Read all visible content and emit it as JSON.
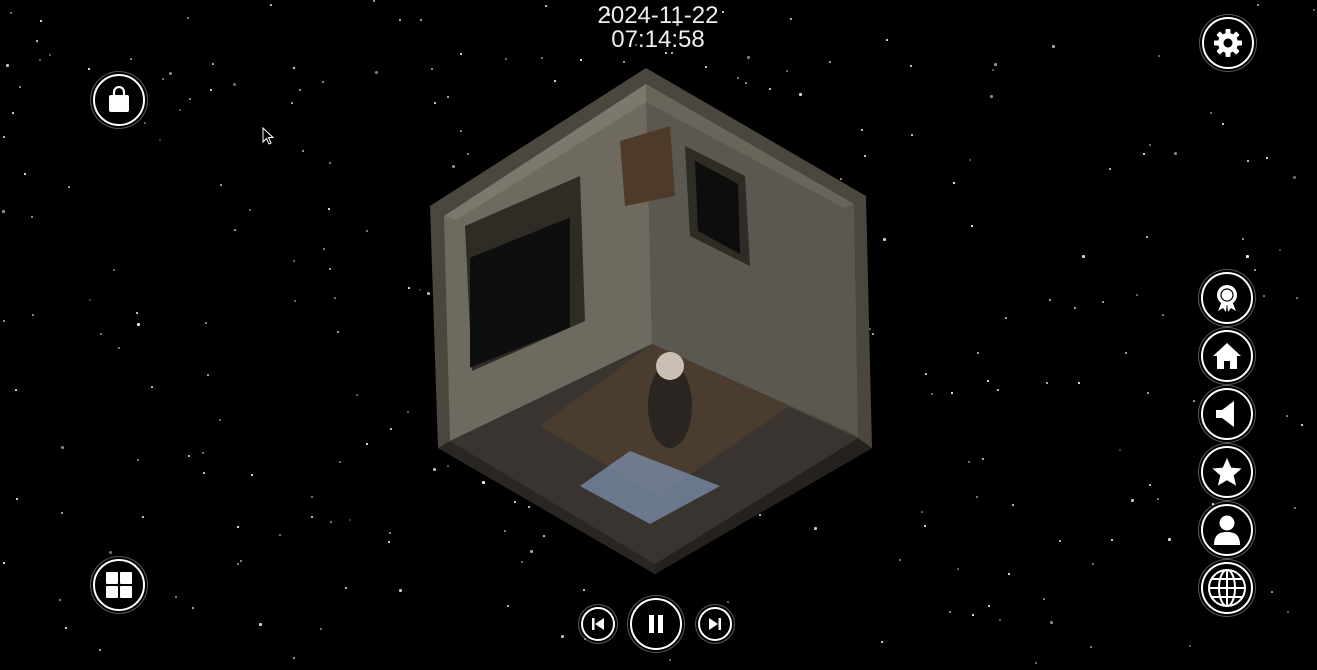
{
  "clock": {
    "date": "2024-11-22",
    "time": "07:14:58"
  },
  "icons": {
    "shop": "shopping-bag-icon",
    "settings": "gear-icon",
    "grid": "grid-icon",
    "badge": "badge-icon",
    "home": "home-icon",
    "sound": "speaker-icon",
    "favorite": "star-icon",
    "profile": "user-icon",
    "language": "globe-icon",
    "prev": "skip-previous-icon",
    "pause": "pause-icon",
    "next": "skip-next-icon"
  },
  "colors": {
    "background": "#000000",
    "icon": "#ffffff"
  }
}
